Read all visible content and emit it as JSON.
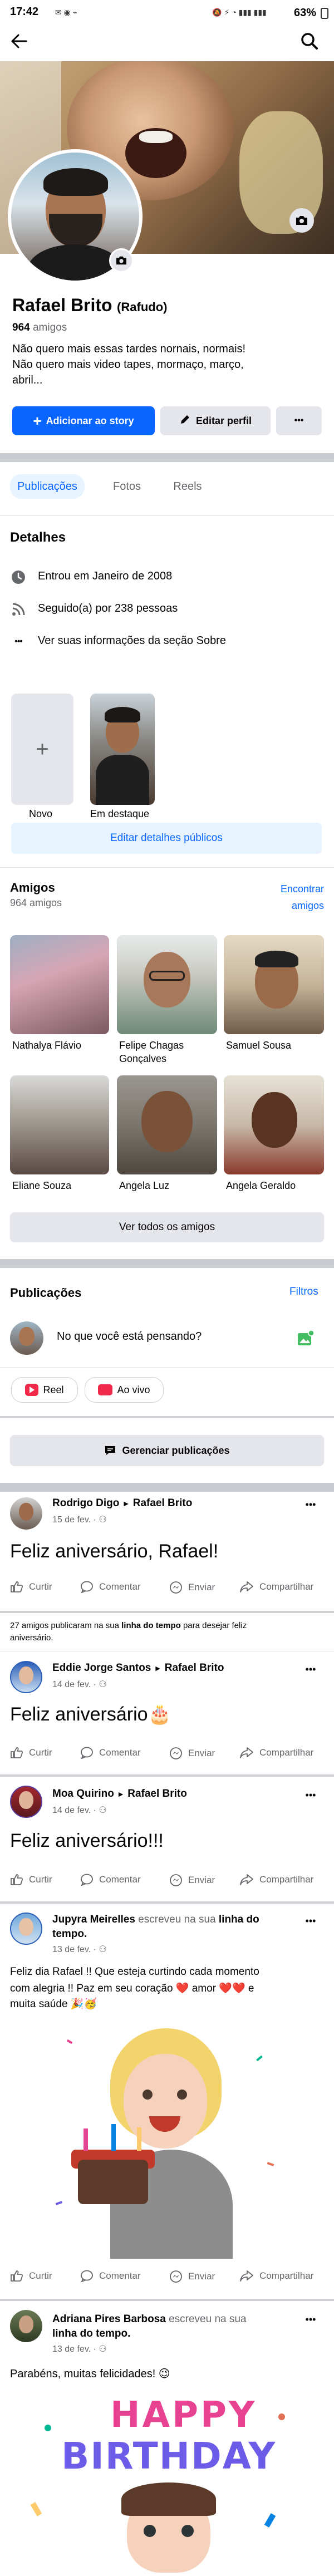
{
  "status_bar": {
    "time": "17:42",
    "battery": "63%"
  },
  "profile": {
    "name": "Rafael Brito",
    "alt_name": "(Rafudo)",
    "friends_count": "964",
    "friends_label": "amigos",
    "bio_line1": "Não quero mais essas tardes nornais, normais!",
    "bio_line2": "Não quero mais video tapes, mormaço, março,",
    "bio_line3": "abril..."
  },
  "actions": {
    "add_story": "Adicionar ao story",
    "edit_profile": "Editar perfil",
    "more": "•••"
  },
  "tabs": [
    {
      "label": "Publicações"
    },
    {
      "label": "Fotos"
    },
    {
      "label": "Reels"
    }
  ],
  "details": {
    "title": "Detalhes",
    "items": [
      {
        "icon": "clock-icon",
        "text": "Entrou em Janeiro de 2008"
      },
      {
        "icon": "rss-icon",
        "text": "Seguido(a) por 238 pessoas"
      },
      {
        "icon": "more-dots-icon",
        "text": "Ver suas informações da seção Sobre"
      }
    ]
  },
  "highlights": {
    "new_label": "Novo",
    "featured_label": "Em destaque",
    "edit_public": "Editar detalhes públicos"
  },
  "friends": {
    "title": "Amigos",
    "count": "964 amigos",
    "find_line1": "Encontrar",
    "find_line2": "amigos",
    "list": [
      {
        "name": "Nathalya Flávio",
        "name2": ""
      },
      {
        "name": "Felipe Chagas",
        "name2": "Gonçalves"
      },
      {
        "name": "Samuel Sousa",
        "name2": ""
      },
      {
        "name": "Eliane Souza",
        "name2": ""
      },
      {
        "name": "Angela Luz",
        "name2": ""
      },
      {
        "name": "Angela Geraldo",
        "name2": ""
      }
    ],
    "see_all": "Ver todos os amigos"
  },
  "publications": {
    "title": "Publicações",
    "filters": "Filtros",
    "composer_placeholder": "No que você está pensando?",
    "reel": "Reel",
    "live": "Ao vivo",
    "manage": "Gerenciar publicações"
  },
  "post_actions": {
    "like": "Curtir",
    "comment": "Comentar",
    "send": "Enviar",
    "share": "Compartilhar"
  },
  "posts": [
    {
      "author": "Rodrigo Digo",
      "target": "Rafael Brito",
      "date": "15 de fev.",
      "text": "Feliz aniversário, Rafael!"
    },
    {
      "author": "Eddie Jorge Santos",
      "target": "Rafael Brito",
      "date": "14 de fev.",
      "text": "Feliz aniversário🎂"
    },
    {
      "author": "Moa Quirino",
      "target": "Rafael Brito",
      "date": "14 de fev.",
      "text": "Feliz aniversário!!!"
    },
    {
      "author": "Jupyra Meirelles",
      "wrote": "escreveu na sua",
      "timeline": "linha do",
      "timeline2": "tempo.",
      "date": "13 de fev.",
      "text1": "Feliz dia Rafael !! Que esteja curtindo cada momento",
      "text2": "com alegria !! Paz em seu coração ❤️ amor ❤️❤️ e",
      "text3": "muita saúde 🎉🥳"
    },
    {
      "author": "Adriana Pires Barbosa",
      "wrote": "escreveu na sua",
      "timeline": "linha do tempo.",
      "date": "13 de fev.",
      "text": "Parabéns, muitas felicidades! 😉"
    }
  ],
  "birthday_notice": {
    "line1a": "27 amigos publicaram na sua ",
    "line1b": "linha do tempo",
    "line1c": " para desejar feliz",
    "line2": "aniversário."
  },
  "happy_birthday": {
    "line1": "HAPPY",
    "line2": "BIRTHDAY"
  }
}
